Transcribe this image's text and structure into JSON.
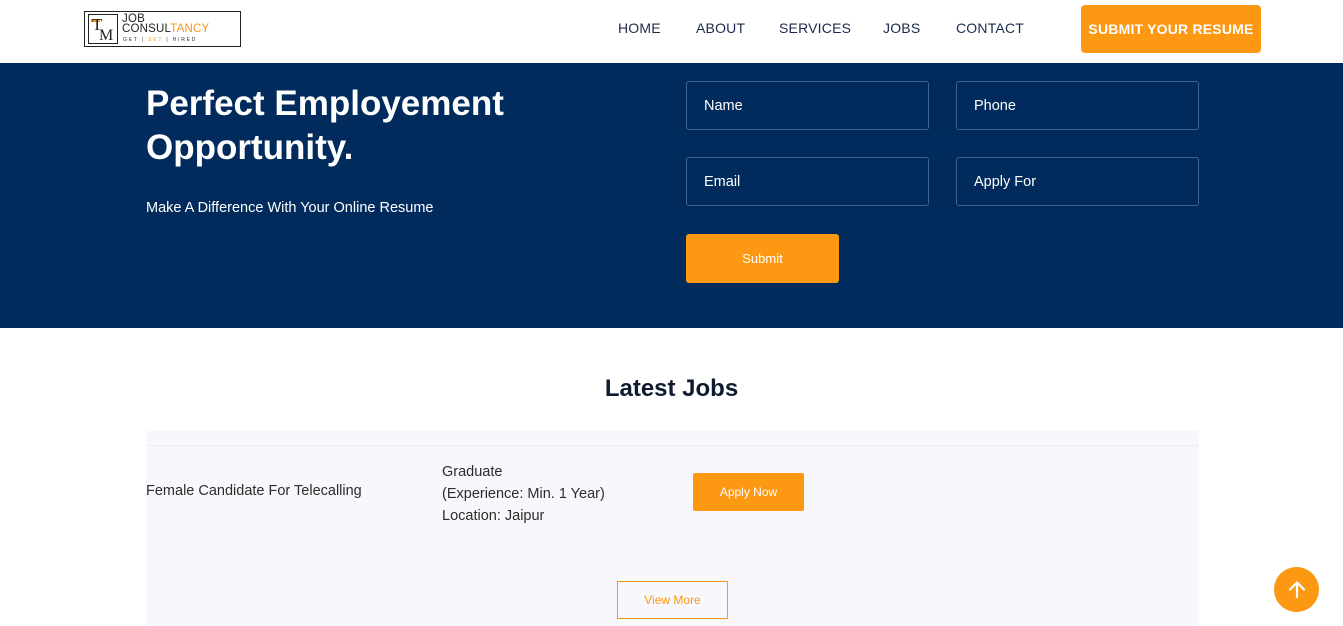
{
  "brand": {
    "logo_mark_t": "T",
    "logo_mark_m": "M",
    "name_line1": "JOB",
    "name_line2_main": "CONSUL",
    "name_line2_accent": "TANCY",
    "tagline_a": "GET | ",
    "tagline_accent": "SET",
    "tagline_b": " | HIRED",
    "accent_color": "#fd9813",
    "navy_color": "#002b5c"
  },
  "nav": {
    "home": "HOME",
    "about": "ABOUT",
    "services": "SERVICES",
    "jobs": "JOBS",
    "contact": "CONTACT",
    "cta": "SUBMIT YOUR RESUME"
  },
  "hero": {
    "title_line1": "Perfect Employement",
    "title_line2": "Opportunity.",
    "subtitle": "Make A Difference With Your Online Resume",
    "form": {
      "name_placeholder": "Name",
      "phone_placeholder": "Phone",
      "email_placeholder": "Email",
      "apply_for_placeholder": "Apply For",
      "submit_label": "Submit"
    }
  },
  "latest_jobs": {
    "heading": "Latest Jobs",
    "jobs": [
      {
        "title": "Female Candidate For Telecalling",
        "qualification": "Graduate",
        "experience": "(Experience: Min. 1 Year)",
        "location": "Location: Jaipur",
        "apply_label": "Apply Now"
      }
    ],
    "view_more_label": "View More"
  },
  "scroll_top_icon": "arrow-up-icon"
}
